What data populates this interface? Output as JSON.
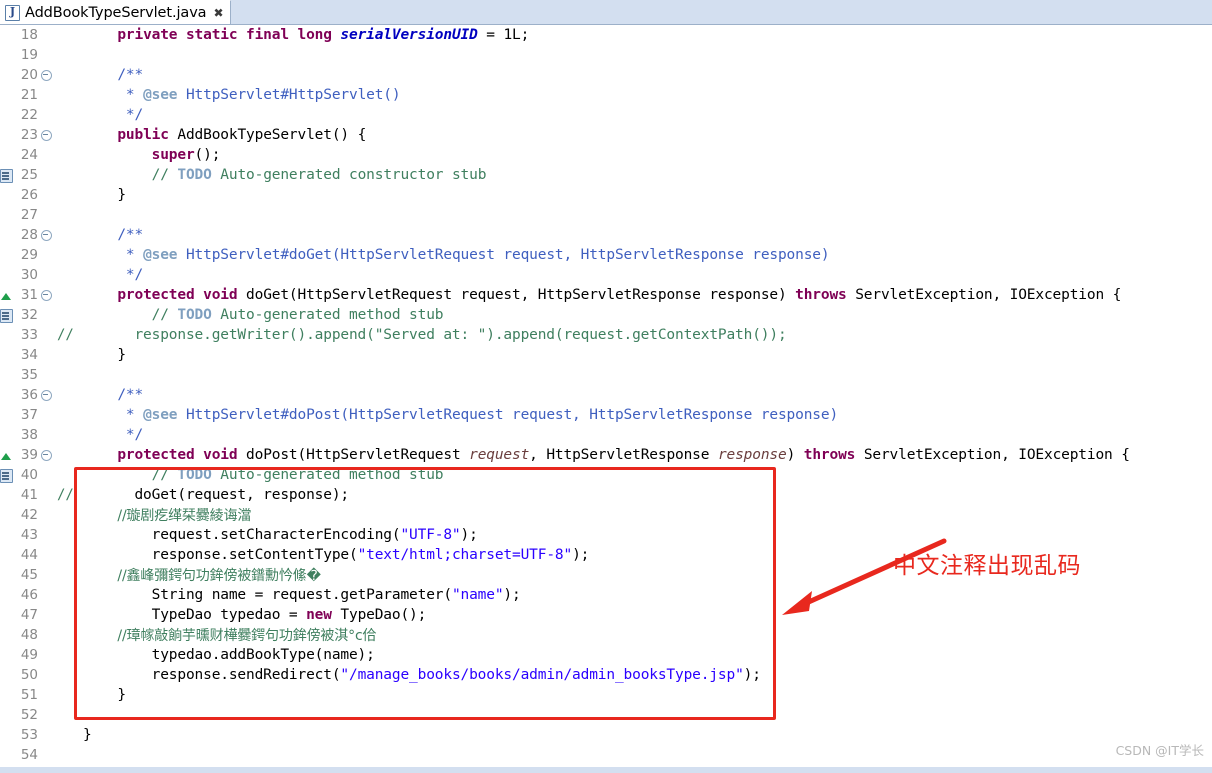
{
  "window": {
    "application": "Eclipse IDE",
    "accent_color": "#d3dff0",
    "annotation_color": "#e8281e"
  },
  "tab": {
    "icon": "java-file-icon",
    "title": "AddBookTypeServlet.java",
    "close_glyph": "✖"
  },
  "annotation": {
    "text": "中文注释出现乱码",
    "meaning": "Chinese comments appear garbled",
    "color": "#e8281e"
  },
  "watermark": {
    "text": "CSDN @IT学长"
  },
  "gutter": {
    "marker_override": "override-marker",
    "marker_todo": "todo-task-marker",
    "fold_collapse": "fold-collapse-icon"
  },
  "editor": {
    "first_line": 18,
    "last_line": 54,
    "lines": [
      {
        "n": 18,
        "marker": "",
        "fold": "",
        "cmt": ""
      },
      {
        "n": 19,
        "marker": "",
        "fold": "",
        "cmt": ""
      },
      {
        "n": 20,
        "marker": "",
        "fold": "minus",
        "cmt": ""
      },
      {
        "n": 21,
        "marker": "",
        "fold": "",
        "cmt": ""
      },
      {
        "n": 22,
        "marker": "",
        "fold": "",
        "cmt": ""
      },
      {
        "n": 23,
        "marker": "",
        "fold": "minus",
        "cmt": ""
      },
      {
        "n": 24,
        "marker": "",
        "fold": "",
        "cmt": ""
      },
      {
        "n": 25,
        "marker": "todo",
        "fold": "",
        "cmt": ""
      },
      {
        "n": 26,
        "marker": "",
        "fold": "",
        "cmt": ""
      },
      {
        "n": 27,
        "marker": "",
        "fold": "",
        "cmt": ""
      },
      {
        "n": 28,
        "marker": "",
        "fold": "minus",
        "cmt": ""
      },
      {
        "n": 29,
        "marker": "",
        "fold": "",
        "cmt": ""
      },
      {
        "n": 30,
        "marker": "",
        "fold": "",
        "cmt": ""
      },
      {
        "n": 31,
        "marker": "override",
        "fold": "minus",
        "cmt": ""
      },
      {
        "n": 32,
        "marker": "todo",
        "fold": "",
        "cmt": ""
      },
      {
        "n": 33,
        "marker": "",
        "fold": "",
        "cmt": "//"
      },
      {
        "n": 34,
        "marker": "",
        "fold": "",
        "cmt": ""
      },
      {
        "n": 35,
        "marker": "",
        "fold": "",
        "cmt": ""
      },
      {
        "n": 36,
        "marker": "",
        "fold": "minus",
        "cmt": ""
      },
      {
        "n": 37,
        "marker": "",
        "fold": "",
        "cmt": ""
      },
      {
        "n": 38,
        "marker": "",
        "fold": "",
        "cmt": ""
      },
      {
        "n": 39,
        "marker": "override",
        "fold": "minus",
        "cmt": ""
      },
      {
        "n": 40,
        "marker": "todo",
        "fold": "",
        "cmt": ""
      },
      {
        "n": 41,
        "marker": "",
        "fold": "",
        "cmt": "//"
      },
      {
        "n": 42,
        "marker": "",
        "fold": "",
        "cmt": ""
      },
      {
        "n": 43,
        "marker": "",
        "fold": "",
        "cmt": ""
      },
      {
        "n": 44,
        "marker": "",
        "fold": "",
        "cmt": ""
      },
      {
        "n": 45,
        "marker": "",
        "fold": "",
        "cmt": ""
      },
      {
        "n": 46,
        "marker": "",
        "fold": "",
        "cmt": ""
      },
      {
        "n": 47,
        "marker": "",
        "fold": "",
        "cmt": ""
      },
      {
        "n": 48,
        "marker": "",
        "fold": "",
        "cmt": ""
      },
      {
        "n": 49,
        "marker": "",
        "fold": "",
        "cmt": ""
      },
      {
        "n": 50,
        "marker": "",
        "fold": "",
        "cmt": ""
      },
      {
        "n": 51,
        "marker": "",
        "fold": "",
        "cmt": ""
      },
      {
        "n": 52,
        "marker": "",
        "fold": "",
        "cmt": ""
      },
      {
        "n": 53,
        "marker": "",
        "fold": "",
        "cmt": ""
      },
      {
        "n": 54,
        "marker": "",
        "fold": "",
        "cmt": ""
      }
    ],
    "code": {
      "18": "    private static final long serialVersionUID = 1L;",
      "19": "",
      "20": "    /**",
      "21": "     * @see HttpServlet#HttpServlet()",
      "22": "     */",
      "23": "    public AddBookTypeServlet() {",
      "24": "        super();",
      "25": "        // TODO Auto-generated constructor stub",
      "26": "    }",
      "27": "",
      "28": "    /**",
      "29": "     * @see HttpServlet#doGet(HttpServletRequest request, HttpServletResponse response)",
      "30": "     */",
      "31": "    protected void doGet(HttpServletRequest request, HttpServletResponse response) throws ServletException, IOException {",
      "32": "        // TODO Auto-generated method stub",
      "33": "        response.getWriter().append(\"Served at: \").append(request.getContextPath());",
      "34": "    }",
      "35": "",
      "36": "    /**",
      "37": "     * @see HttpServlet#doPost(HttpServletRequest request, HttpServletResponse response)",
      "38": "     */",
      "39": "    protected void doPost(HttpServletRequest request, HttpServletResponse response) throws ServletException, IOException {",
      "40": "        // TODO Auto-generated method stub",
      "41": "        doGet(request, response);",
      "42": "        //璇剧疙缂栞爨綾诲澢",
      "43": "        request.setCharacterEncoding(\"UTF-8\");",
      "44": "        response.setContentType(\"text/html;charset=UTF-8\");",
      "45": "        //鑫峰彌鍔句功鉾傍被鐠勳忴絛�",
      "46": "        String name = request.getParameter(\"name\");",
      "47": "        TypeDao typedao = new TypeDao();",
      "48": "        //璋幏敲餉芋曛财樺爨鍔句功鉾傍被淇°c佮",
      "49": "        typedao.addBookType(name);",
      "50": "        response.sendRedirect(\"/manage_books/books/admin/admin_booksType.jsp\");",
      "51": "    }",
      "52": "",
      "53": "}",
      "54": ""
    }
  }
}
